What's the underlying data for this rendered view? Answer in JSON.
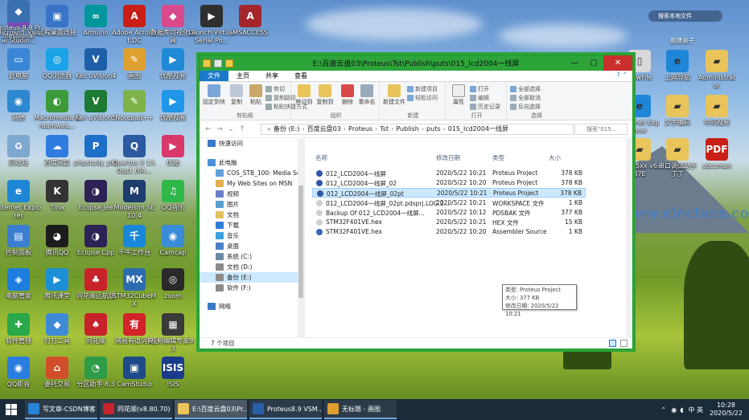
{
  "desktop": {
    "icons": [
      {
        "label": "Microsoft Visual Studio...",
        "color": "#7c4dbd",
        "glyph": "∞"
      },
      {
        "label": "远程桌面连接",
        "color": "#3a74c8",
        "glyph": "▣"
      },
      {
        "label": "Arduino",
        "color": "#00979c",
        "glyph": "∞"
      },
      {
        "label": "Adobe Acrobat DC",
        "color": "#c91f16",
        "glyph": "A"
      },
      {
        "label": "数据库可视化工具",
        "color": "#d94a8c",
        "glyph": "◆"
      },
      {
        "label": "Launch Virtual Serial Po...",
        "color": "#2f2f2f",
        "glyph": "▶"
      },
      {
        "label": "MSACCESS",
        "color": "#a4262c",
        "glyph": "A"
      },
      {
        "label": "此电脑",
        "color": "#3a86d6",
        "glyph": "▭"
      },
      {
        "label": "QQ浏览器",
        "color": "#1aa3e8",
        "glyph": "◎"
      },
      {
        "label": "Keil uVision4",
        "color": "#1f5fa8",
        "glyph": "V"
      },
      {
        "label": "画图",
        "color": "#e0a030",
        "glyph": "✎"
      },
      {
        "label": "优酷视频",
        "color": "#1f8ad8",
        "glyph": "▶"
      },
      {
        "label": "网络",
        "color": "#2d88d0",
        "glyph": "◉"
      },
      {
        "label": "Macromedia Dreamwea...",
        "color": "#3d9a3a",
        "glyph": "◐"
      },
      {
        "label": "Keil uVision5",
        "color": "#1d7a32",
        "glyph": "V"
      },
      {
        "label": "Notepad++",
        "color": "#7db34a",
        "glyph": "✎"
      },
      {
        "label": "优酷视频",
        "color": "#2096e8",
        "glyph": "▶"
      },
      {
        "label": "回收站",
        "color": "#7fa8cf",
        "glyph": "♻"
      },
      {
        "label": "百度网盘",
        "color": "#2f7be0",
        "glyph": "☁"
      },
      {
        "label": "phpstudy_pro",
        "color": "#1e6fc8",
        "glyph": "P"
      },
      {
        "label": "Quartus II 13.0sp1 (64...",
        "color": "#2c5aa0",
        "glyph": "Q"
      },
      {
        "label": "优酷",
        "color": "#d9386a",
        "glyph": "▶"
      },
      {
        "label": "Internet Explorer",
        "color": "#1d86d6",
        "glyph": "e"
      },
      {
        "label": "Tina",
        "color": "#333333",
        "glyph": "K"
      },
      {
        "label": "Eclipse Jee",
        "color": "#2c2255",
        "glyph": "◑"
      },
      {
        "label": "Modelsim SE 10.4",
        "color": "#1e3c6e",
        "glyph": "M"
      },
      {
        "label": "QQ音乐",
        "color": "#2eb848",
        "glyph": "♫"
      },
      {
        "label": "控制面板",
        "color": "#3a7fd2",
        "glyph": "▤"
      },
      {
        "label": "腾讯QQ",
        "color": "#1c1c1c",
        "glyph": "◕"
      },
      {
        "label": "Eclipse Cpp",
        "color": "#2c2255",
        "glyph": "◑"
      },
      {
        "label": "千牛工作台",
        "color": "#1a88d8",
        "glyph": "千"
      },
      {
        "label": "Camcap",
        "color": "#3a8bd8",
        "glyph": "◉"
      },
      {
        "label": "电脑管家",
        "color": "#1d7ee0",
        "glyph": "◈"
      },
      {
        "label": "腾讯课堂",
        "color": "#1c8fd6",
        "glyph": "▶"
      },
      {
        "label": "同花顺远航版",
        "color": "#c8222a",
        "glyph": "♣"
      },
      {
        "label": "STM32CubeMX",
        "color": "#2c6bb0",
        "glyph": "MX"
      },
      {
        "label": "zoom",
        "color": "#2a2a2a",
        "glyph": "◎"
      },
      {
        "label": "软件管理",
        "color": "#2aa84a",
        "glyph": "✚"
      },
      {
        "label": "钉钉工具",
        "color": "#3d8bd6",
        "glyph": "◆"
      },
      {
        "label": "同花顺",
        "color": "#c8222a",
        "glyph": "♠"
      },
      {
        "label": "网易有道词典",
        "color": "#d2232a",
        "glyph": "有"
      },
      {
        "label": "视频编辑专家9.3",
        "color": "#3a3a3a",
        "glyph": "▦"
      },
      {
        "label": "QQ影音",
        "color": "#2a7de0",
        "glyph": "◉"
      },
      {
        "label": "委托交易",
        "color": "#d24d2a",
        "glyph": "⌂"
      },
      {
        "label": "分区助手 8.3",
        "color": "#2f9c48",
        "glyph": "◔"
      },
      {
        "label": "CamStudio",
        "color": "#1f4b8a",
        "glyph": "▣"
      },
      {
        "label": "ISIS",
        "color": "#1a3b8a",
        "glyph": "ISIS"
      },
      {
        "label": "Proteus 8.9 Professional",
        "color": "#3a6fb0",
        "glyph": "◆"
      }
    ],
    "right_icons": [
      {
        "label": "NewFile",
        "color": "#d8d8d8",
        "glyph": "▯"
      },
      {
        "label": "上网导航",
        "color": "#1d86d6",
        "glyph": "e"
      },
      {
        "label": "Administrator",
        "color": "#e8c45a",
        "glyph": "▰"
      },
      {
        "label": "Internet Explorer",
        "color": "#1d86d6",
        "glyph": "e"
      },
      {
        "label": "文字编码",
        "color": "#e8c45a",
        "glyph": "▰"
      },
      {
        "label": "中间视频",
        "color": "#e8c45a",
        "glyph": "▰"
      },
      {
        "label": "isp-15xx v6.87E",
        "color": "#e8c45a",
        "glyph": "▰"
      },
      {
        "label": "串口调试助手 丁丁",
        "color": "#e8c45a",
        "glyph": "▰"
      },
      {
        "label": "sdccman",
        "color": "#c91f16",
        "glyph": "PDF"
      }
    ],
    "side_search": "搜索本地文件",
    "side_title": "新建桌子",
    "watermark": "www.elecfans.com"
  },
  "window": {
    "title": "E:\\百度云盘03\\Proteus\\Tst\\Publish\\puts\\015_lcd2004一线屏",
    "ribbon_tabs": [
      "文件",
      "主页",
      "共享",
      "查看"
    ],
    "ribbon": {
      "clipboard": {
        "name": "剪贴板",
        "pin": "固定到快速访问",
        "copy": "复制",
        "paste": "粘贴",
        "cut": "剪切",
        "copy_path": "复制路径",
        "paste_shortcut": "粘贴快捷方式"
      },
      "organize": {
        "name": "组织",
        "move_to": "移动到",
        "copy_to": "复制到",
        "delete": "删除",
        "rename": "重命名"
      },
      "new": {
        "name": "新建",
        "new_folder": "新建文件夹",
        "new_item": "新建项目",
        "easy_access": "轻松访问"
      },
      "open": {
        "name": "打开",
        "properties": "属性",
        "open": "打开",
        "edit": "编辑",
        "history": "历史记录"
      },
      "select": {
        "name": "选择",
        "select_all": "全部选择",
        "select_none": "全部取消",
        "invert": "反向选择"
      }
    },
    "breadcrumb": [
      "备份 (E:)",
      "百度云盘03",
      "Proteus",
      "Tst",
      "Publish",
      "puts",
      "015_lcd2004一线屏"
    ],
    "search_placeholder": "搜索\"015...",
    "nav": [
      {
        "label": "快速访问",
        "color": "#3a78c8"
      },
      {
        "label": "此电脑",
        "color": "#4a90d8"
      },
      {
        "label": "COS_STB_100: Media Serv",
        "color": "#5fa0d8"
      },
      {
        "label": "My Web Sites on MSN",
        "color": "#e0b050"
      },
      {
        "label": "视频",
        "color": "#6a7fc8"
      },
      {
        "label": "图片",
        "color": "#5aa0d0"
      },
      {
        "label": "文档",
        "color": "#e0c060"
      },
      {
        "label": "下载",
        "color": "#2f7fd8"
      },
      {
        "label": "音乐",
        "color": "#3aa0e0"
      },
      {
        "label": "桌面",
        "color": "#4a80c8"
      },
      {
        "label": "系统 (C:)",
        "color": "#6a8aa8"
      },
      {
        "label": "文档 (D:)",
        "color": "#8a8a8a"
      },
      {
        "label": "备份 (E:)",
        "color": "#8a8a8a"
      },
      {
        "label": "软件 (F:)",
        "color": "#8a8a8a"
      },
      {
        "label": "网络",
        "color": "#3a78c8"
      }
    ],
    "columns": {
      "name": "名称",
      "date": "修改日期",
      "type": "类型",
      "size": "大小"
    },
    "files": [
      {
        "name": "012_LCD2004一线屏",
        "date": "2020/5/22 10:21",
        "type": "Proteus Project",
        "size": "378 KB",
        "color": "#2f56a8"
      },
      {
        "name": "012_LCD2004一线屏_02",
        "date": "2020/5/22 10:20",
        "type": "Proteus Project",
        "size": "378 KB",
        "color": "#2f56a8"
      },
      {
        "name": "012_LCD2004一线屏_02pt",
        "date": "2020/5/22 10:21",
        "type": "Proteus Project",
        "size": "378 KB",
        "color": "#2f56a8"
      },
      {
        "name": "012_LCD2004一线屏_02pt.pdsprj.LOG.2...",
        "date": "2020/5/22 10:21",
        "type": "WORKSPACE 文件",
        "size": "1 KB",
        "color": "#d0d0d0"
      },
      {
        "name": "Backup Of 012_LCD2004一线屏...",
        "date": "2020/5/22 10:12",
        "type": "PDSBAK 文件",
        "size": "377 KB",
        "color": "#d0d0d0"
      },
      {
        "name": "STM32F401VE.hex",
        "date": "2020/5/22 10:21",
        "type": "HEX 文件",
        "size": "15 KB",
        "color": "#d0d0d0"
      },
      {
        "name": "STM32F401VE.hex",
        "date": "2020/5/22 10:20",
        "type": "Assembler Source",
        "size": "1 KB",
        "color": "#3a66b8"
      }
    ],
    "tooltip": {
      "type": "类型: Proteus Project",
      "size": "大小: 377 KB",
      "date": "修改日期: 2020/5/22 10:21"
    },
    "status": "7 个项目"
  },
  "taskbar": {
    "apps": [
      {
        "label": "写文章-CSDN博客",
        "color": "#2a82d6"
      },
      {
        "label": "同花顺(v8.80.70) -...",
        "color": "#c8222a"
      },
      {
        "label": "E:\\百度云盘03\\Pr...",
        "color": "#e8c45a"
      },
      {
        "label": "Proteus8.9 VSM...",
        "color": "#2b5ea8"
      },
      {
        "label": "无标题 - 画图",
        "color": "#e0a030"
      }
    ],
    "tray": "中 英",
    "time": "10:28",
    "date": "2020/5/22"
  }
}
